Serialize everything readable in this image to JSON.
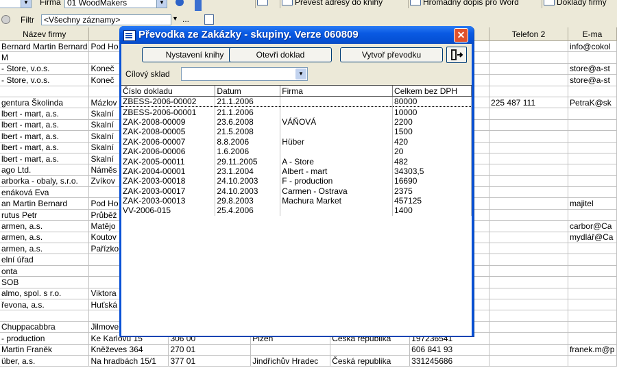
{
  "toolbar1": {
    "firma_label": "Firma",
    "firma_value": "01 WoodMakers",
    "buttons": [
      {
        "label": "Převést adresy do knihy",
        "icon": "address-book-icon"
      },
      {
        "label": "Hromadný dopis pro Word",
        "icon": "word-letter-icon"
      },
      {
        "label": "Doklady firmy",
        "icon": "documents-icon"
      }
    ]
  },
  "toolbar2": {
    "filtr_label": "Filtr",
    "filtr_value": "<Všechny záznamy>",
    "ellipsis": "..."
  },
  "grid": {
    "columns": [
      "Název firmy",
      "",
      "",
      "",
      "",
      "",
      "Telefon 2",
      "E-ma"
    ],
    "rows": [
      [
        "Bernard Martin Bernard",
        "Pod Ho",
        "",
        "",
        "",
        "",
        "",
        "info@cokol"
      ],
      [
        "M",
        "",
        "",
        "",
        "",
        "",
        "",
        ""
      ],
      [
        " - Store, v.o.s.",
        "Koneč",
        "",
        "",
        "",
        "",
        "",
        "store@a-st"
      ],
      [
        " - Store, v.o.s.",
        "Koneč",
        "",
        "",
        "",
        "",
        "",
        "store@a-st"
      ],
      [
        "",
        "",
        "",
        "",
        "",
        "",
        "",
        ""
      ],
      [
        "gentura Školinda",
        "Mázlov",
        "",
        "",
        "",
        "",
        "225 487 111",
        "PetraK@sk"
      ],
      [
        "lbert - mart, a.s.",
        "Skalní",
        "",
        "",
        "",
        "",
        "",
        ""
      ],
      [
        "lbert - mart, a.s.",
        "Skalní",
        "",
        "",
        "",
        "",
        "",
        ""
      ],
      [
        "lbert - mart, a.s.",
        "Skalní",
        "",
        "",
        "",
        "",
        "",
        ""
      ],
      [
        "lbert - mart, a.s.",
        "Skalní",
        "",
        "",
        "",
        "",
        "",
        ""
      ],
      [
        "lbert - mart, a.s.",
        "Skalní",
        "",
        "",
        "",
        "",
        "",
        ""
      ],
      [
        "ago Ltd.",
        "Náměs",
        "",
        "",
        "",
        "",
        "",
        ""
      ],
      [
        "arborka - obaly, s.r.o.",
        "Zvíkov",
        "",
        "",
        "",
        "",
        "",
        ""
      ],
      [
        "enáková Eva",
        "",
        "",
        "",
        "",
        "",
        "",
        ""
      ],
      [
        "an Martin Bernard",
        "Pod Ho",
        "",
        "",
        "",
        "",
        "",
        "majitel"
      ],
      [
        "rutus Petr",
        "Průběž",
        "",
        "",
        "",
        "",
        "",
        ""
      ],
      [
        "armen, a.s.",
        "Matějo",
        "",
        "",
        "",
        "",
        "",
        "carbor@Ca"
      ],
      [
        "armen, a.s.",
        "Koutov",
        "",
        "",
        "",
        "",
        "",
        "mydlář@Ca"
      ],
      [
        "armen, a.s.",
        "Pařízko",
        "",
        "",
        "",
        "",
        "",
        ""
      ],
      [
        "elní úřad",
        "",
        "",
        "",
        "",
        "",
        "",
        ""
      ],
      [
        "onta",
        "",
        "",
        "",
        "",
        "",
        "",
        ""
      ],
      [
        "SOB",
        "",
        "",
        "",
        "",
        "",
        "",
        ""
      ],
      [
        "almo, spol. s r.o.",
        "Viktora",
        "",
        "",
        "",
        "",
        "",
        ""
      ],
      [
        "řevona, a.s.",
        "Huťská",
        "",
        "",
        "",
        "",
        "",
        ""
      ],
      [
        "",
        "",
        "",
        "",
        "",
        "",
        "",
        ""
      ],
      [
        " Chuppacabbra",
        "Jilmove",
        "",
        "",
        "",
        "",
        "",
        ""
      ],
      [
        " - production",
        "Ke Karlovu 15",
        "306 00",
        "Plzeň",
        "Česká republika",
        "197236541",
        "",
        ""
      ],
      [
        "Martin Franěk",
        "Kněževes 364",
        "270 01",
        "",
        "",
        "606 841 93",
        "",
        "franek.m@p"
      ],
      [
        "übe​r, a.s.",
        "Na hradbách 15/1",
        "377 01",
        "Jindřichův Hradec",
        "Česká republika",
        "331245686",
        "",
        ""
      ]
    ]
  },
  "dialog": {
    "title": "Převodka ze Zakázky - skupiny. Verze 060809",
    "buttons": {
      "nastaveni": "Nystavení knihy",
      "otevri": "Otevři doklad",
      "vytvor": "Vytvoř převodku"
    },
    "cilovy_label": "Cílový sklad",
    "sklad_value": "",
    "list": {
      "columns": [
        "Číslo dokladu",
        "Datum",
        "Firma",
        "Celkem bez DPH"
      ],
      "rows": [
        [
          "ZBESS-2006-00002",
          "21.1.2006",
          "",
          "80000"
        ],
        [
          "ZBESS-2006-00001",
          "21.1.2006",
          "",
          "10000"
        ],
        [
          "ZAK-2008-00009",
          "23.6.2008",
          "VÁŇOVÁ",
          "2200"
        ],
        [
          "ZAK-2008-00005",
          "21.5.2008",
          "",
          "1500"
        ],
        [
          "ZAK-2006-00007",
          "8.8.2006",
          "Hüber",
          "420"
        ],
        [
          "ZAK-2006-00006",
          "1.6.2006",
          "",
          "20"
        ],
        [
          "ZAK-2005-00011",
          "29.11.2005",
          "A - Store",
          "482"
        ],
        [
          "ZAK-2004-00001",
          "23.1.2004",
          "Albert - mart",
          "34303,5"
        ],
        [
          "ZAK-2003-00018",
          "24.10.2003",
          "F - production",
          "16690"
        ],
        [
          "ZAK-2003-00017",
          "24.10.2003",
          "Carmen - Ostrava",
          "2375"
        ],
        [
          "ZAK-2003-00013",
          "29.8.2003",
          "Machura Market",
          "457125"
        ],
        [
          "VV-2006-015",
          "25.4.2006",
          "",
          "1400"
        ]
      ]
    }
  }
}
